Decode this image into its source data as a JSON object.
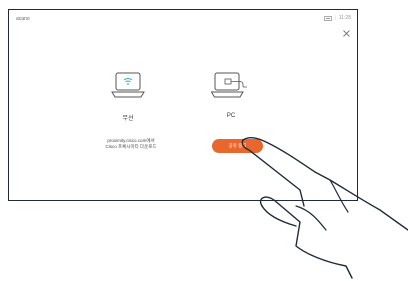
{
  "app": {
    "name": "acano"
  },
  "status": {
    "time": "11:28"
  },
  "options": [
    {
      "label": "무선",
      "icon": "laptop-wireless-icon"
    },
    {
      "label": "PC",
      "icon": "laptop-cable-icon"
    }
  ],
  "hint": {
    "line1": "proximity.cisco.com에서",
    "line2": "Cisco 프록시미티 다운로드"
  },
  "share_button": {
    "label": "공유 중지"
  },
  "colors": {
    "accent": "#e8672f",
    "frame": "#1f2a3a"
  }
}
